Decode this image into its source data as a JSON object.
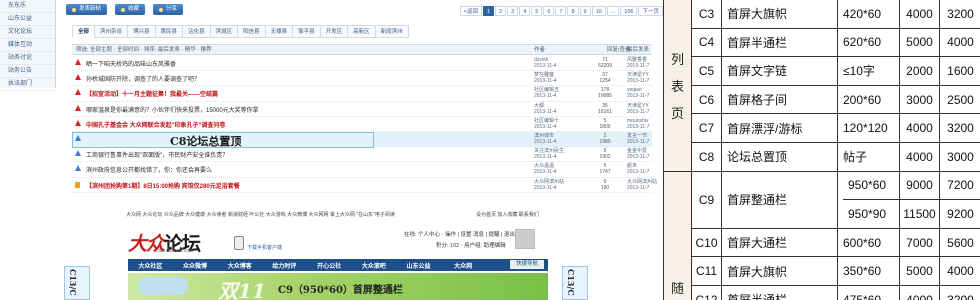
{
  "sidebar": {
    "items": [
      "东东乐",
      "山东公益",
      "文化论坛",
      "媒体互动",
      "站务讨论",
      "站务公告",
      "执法部门",
      "发来问题"
    ]
  },
  "toolbar": {
    "post_label": "发表新帖",
    "fav_label": "收藏",
    "share_label": "分享"
  },
  "pager": [
    "<返回",
    "1",
    "2",
    "3",
    "4",
    "5",
    "6",
    "7",
    "8",
    "9",
    "10",
    "...",
    "106",
    "下一页"
  ],
  "categories": [
    "全部",
    "滨州杂谈",
    "博兴县",
    "惠民县",
    "沾化县",
    "滨城区",
    "阳信县",
    "无棣县",
    "邹平县",
    "开发区",
    "高新区",
    "新闻滨州"
  ],
  "thead": {
    "filter": "筛选: 全部主题 · 全部时间 · 排序: 最后发表 · 精华 · 推荐",
    "author": "作者",
    "replies": "回复/查看",
    "last": "最后发表"
  },
  "threads": [
    {
      "title": "晒一下咱天桥鸡的品味山东风雅香",
      "red": false,
      "icon": "up",
      "author": "dzvsth",
      "date": "2013-11-4",
      "replies": "71",
      "views": "62209",
      "last": "风雅香香",
      "last_date": "2013-11-7"
    },
    {
      "title": "孙桥城国防开除，调查了的人要调查了吧？",
      "red": false,
      "icon": "up",
      "author": "梦在雕塞",
      "date": "2013-11-4",
      "replies": "37",
      "views": "1254",
      "last": "天津星YY",
      "last_date": "2013-11-7"
    },
    {
      "title": "【招宣活动】十一月主题征集！我最关——空结篇",
      "red": true,
      "icon": "up",
      "author": "社区编辑五",
      "date": "2013-11-4",
      "replies": "178",
      "views": "19085",
      "last": "yeqiao",
      "last_date": "2013-11-7"
    },
    {
      "title": "哪家温泉是你最满意的？小伙伴们快来投票，15000元大奖等你拿",
      "red": false,
      "icon": "up",
      "author": "大都",
      "date": "2013-11-4",
      "replies": "35",
      "views": "16161",
      "last": "天津星YY",
      "last_date": "2013-11-7"
    },
    {
      "title": "中国孔子基金会 大众网联合发起\"印象孔子\"调查问卷",
      "red": true,
      "icon": "up",
      "author": "社区编辑十",
      "date": "2013-11-4",
      "replies": "5",
      "views": "1800",
      "last": "mounshiv",
      "last_date": "2013-11-7"
    },
    {
      "title": "C8论坛总置顶",
      "red": false,
      "icon": "blue",
      "author": "滨州城市",
      "date": "2013-11-4",
      "replies": "2",
      "views": "1980",
      "last": "发言一节",
      "last_date": "2013-11-7"
    },
    {
      "title": "工商银行鲁事件出现\"双面版\"，市民财产安全谁负责？",
      "red": false,
      "icon": "blue",
      "author": "关注滨州民生",
      "date": "2013-11-4",
      "replies": "5",
      "views": "1902",
      "last": "金金中爱",
      "last_date": "2013-11-7"
    },
    {
      "title": "滨州政府信息公开都找错了，你：你还会再要么",
      "red": false,
      "icon": "blue",
      "author": "大众温温",
      "date": "2013-11-4",
      "replies": "5",
      "views": "1747",
      "last": "颜末",
      "last_date": "2013-11-7"
    },
    {
      "title": "【滨州团抢购第1期】8日15:00抢购 宾馆仅280元足浴套餐",
      "red": true,
      "icon": "lock",
      "author": "大众网滨州站",
      "date": "2013-11-4",
      "replies": "0",
      "views": "190",
      "last": "大众网滨州站",
      "last_date": "2013-11-7"
    }
  ],
  "footer_links": "大众网  大众论坛  众众品牌  大众健康  大众读者  新浪财经  叶公社  大众游戏  大众微博  大众网网  掌上大众网  \"在山东\"电子阅读",
  "footer_right": "设为首页  加入收藏  联系我们",
  "logo": {
    "brand": "大众",
    "suffix": "论坛",
    "url": "club.dzwww.com"
  },
  "mobile_label": "下载手机客户端",
  "login": {
    "line1": "在线: 个人中心 · 操作 | 设置 消息 | 提醒 | 退出",
    "line2": "积分: 102 · 用户组: 助理编辑"
  },
  "nav": [
    "大众社区",
    "众众微博",
    "大众博客",
    "给力时评",
    "开心公社",
    "大众滚吧",
    "山东公益",
    "大众网"
  ],
  "nav_search": "快捷导航",
  "banner": {
    "text": "C9（950*60）首屏整通栏",
    "overlay": "双11"
  },
  "left_vad": "C13/C",
  "right_vad": "C13/C",
  "ad_table": {
    "group1": [
      "列",
      "表",
      "页"
    ],
    "group2": [
      "随"
    ],
    "rows": [
      {
        "code": "C3",
        "name": "首屏大旗帜",
        "sizes": [
          "420*60"
        ],
        "p1": [
          "4000"
        ],
        "p2": [
          "3200"
        ]
      },
      {
        "code": "C4",
        "name": "首屏半通栏",
        "sizes": [
          "620*60"
        ],
        "p1": [
          "5000"
        ],
        "p2": [
          "4000"
        ]
      },
      {
        "code": "C5",
        "name": "首屏文字链",
        "sizes": [
          "≤10字"
        ],
        "p1": [
          "2000"
        ],
        "p2": [
          "1600"
        ]
      },
      {
        "code": "C6",
        "name": "首屏格子间",
        "sizes": [
          "200*60"
        ],
        "p1": [
          "3000"
        ],
        "p2": [
          "2500"
        ]
      },
      {
        "code": "C7",
        "name": "首屏漂浮/游标",
        "sizes": [
          "120*120"
        ],
        "p1": [
          "4000"
        ],
        "p2": [
          "3200"
        ]
      },
      {
        "code": "C8",
        "name": "论坛总置顶",
        "sizes": [
          "帖子"
        ],
        "p1": [
          "4000"
        ],
        "p2": [
          "3000"
        ]
      },
      {
        "code": "C9",
        "name": "首屏整通栏",
        "sizes": [
          "950*60",
          "950*90"
        ],
        "p1": [
          "9000",
          "11500"
        ],
        "p2": [
          "7200",
          "9200"
        ]
      },
      {
        "code": "C10",
        "name": "首屏大通栏",
        "sizes": [
          "600*60"
        ],
        "p1": [
          "7000"
        ],
        "p2": [
          "5600"
        ]
      },
      {
        "code": "C11",
        "name": "首屏大旗帜",
        "sizes": [
          "350*60"
        ],
        "p1": [
          "5000"
        ],
        "p2": [
          "4000"
        ]
      },
      {
        "code": "C12",
        "name": "首屏半通栏",
        "sizes": [
          "475*60"
        ],
        "p1": [
          "4000"
        ],
        "p2": [
          "3200"
        ]
      }
    ]
  }
}
